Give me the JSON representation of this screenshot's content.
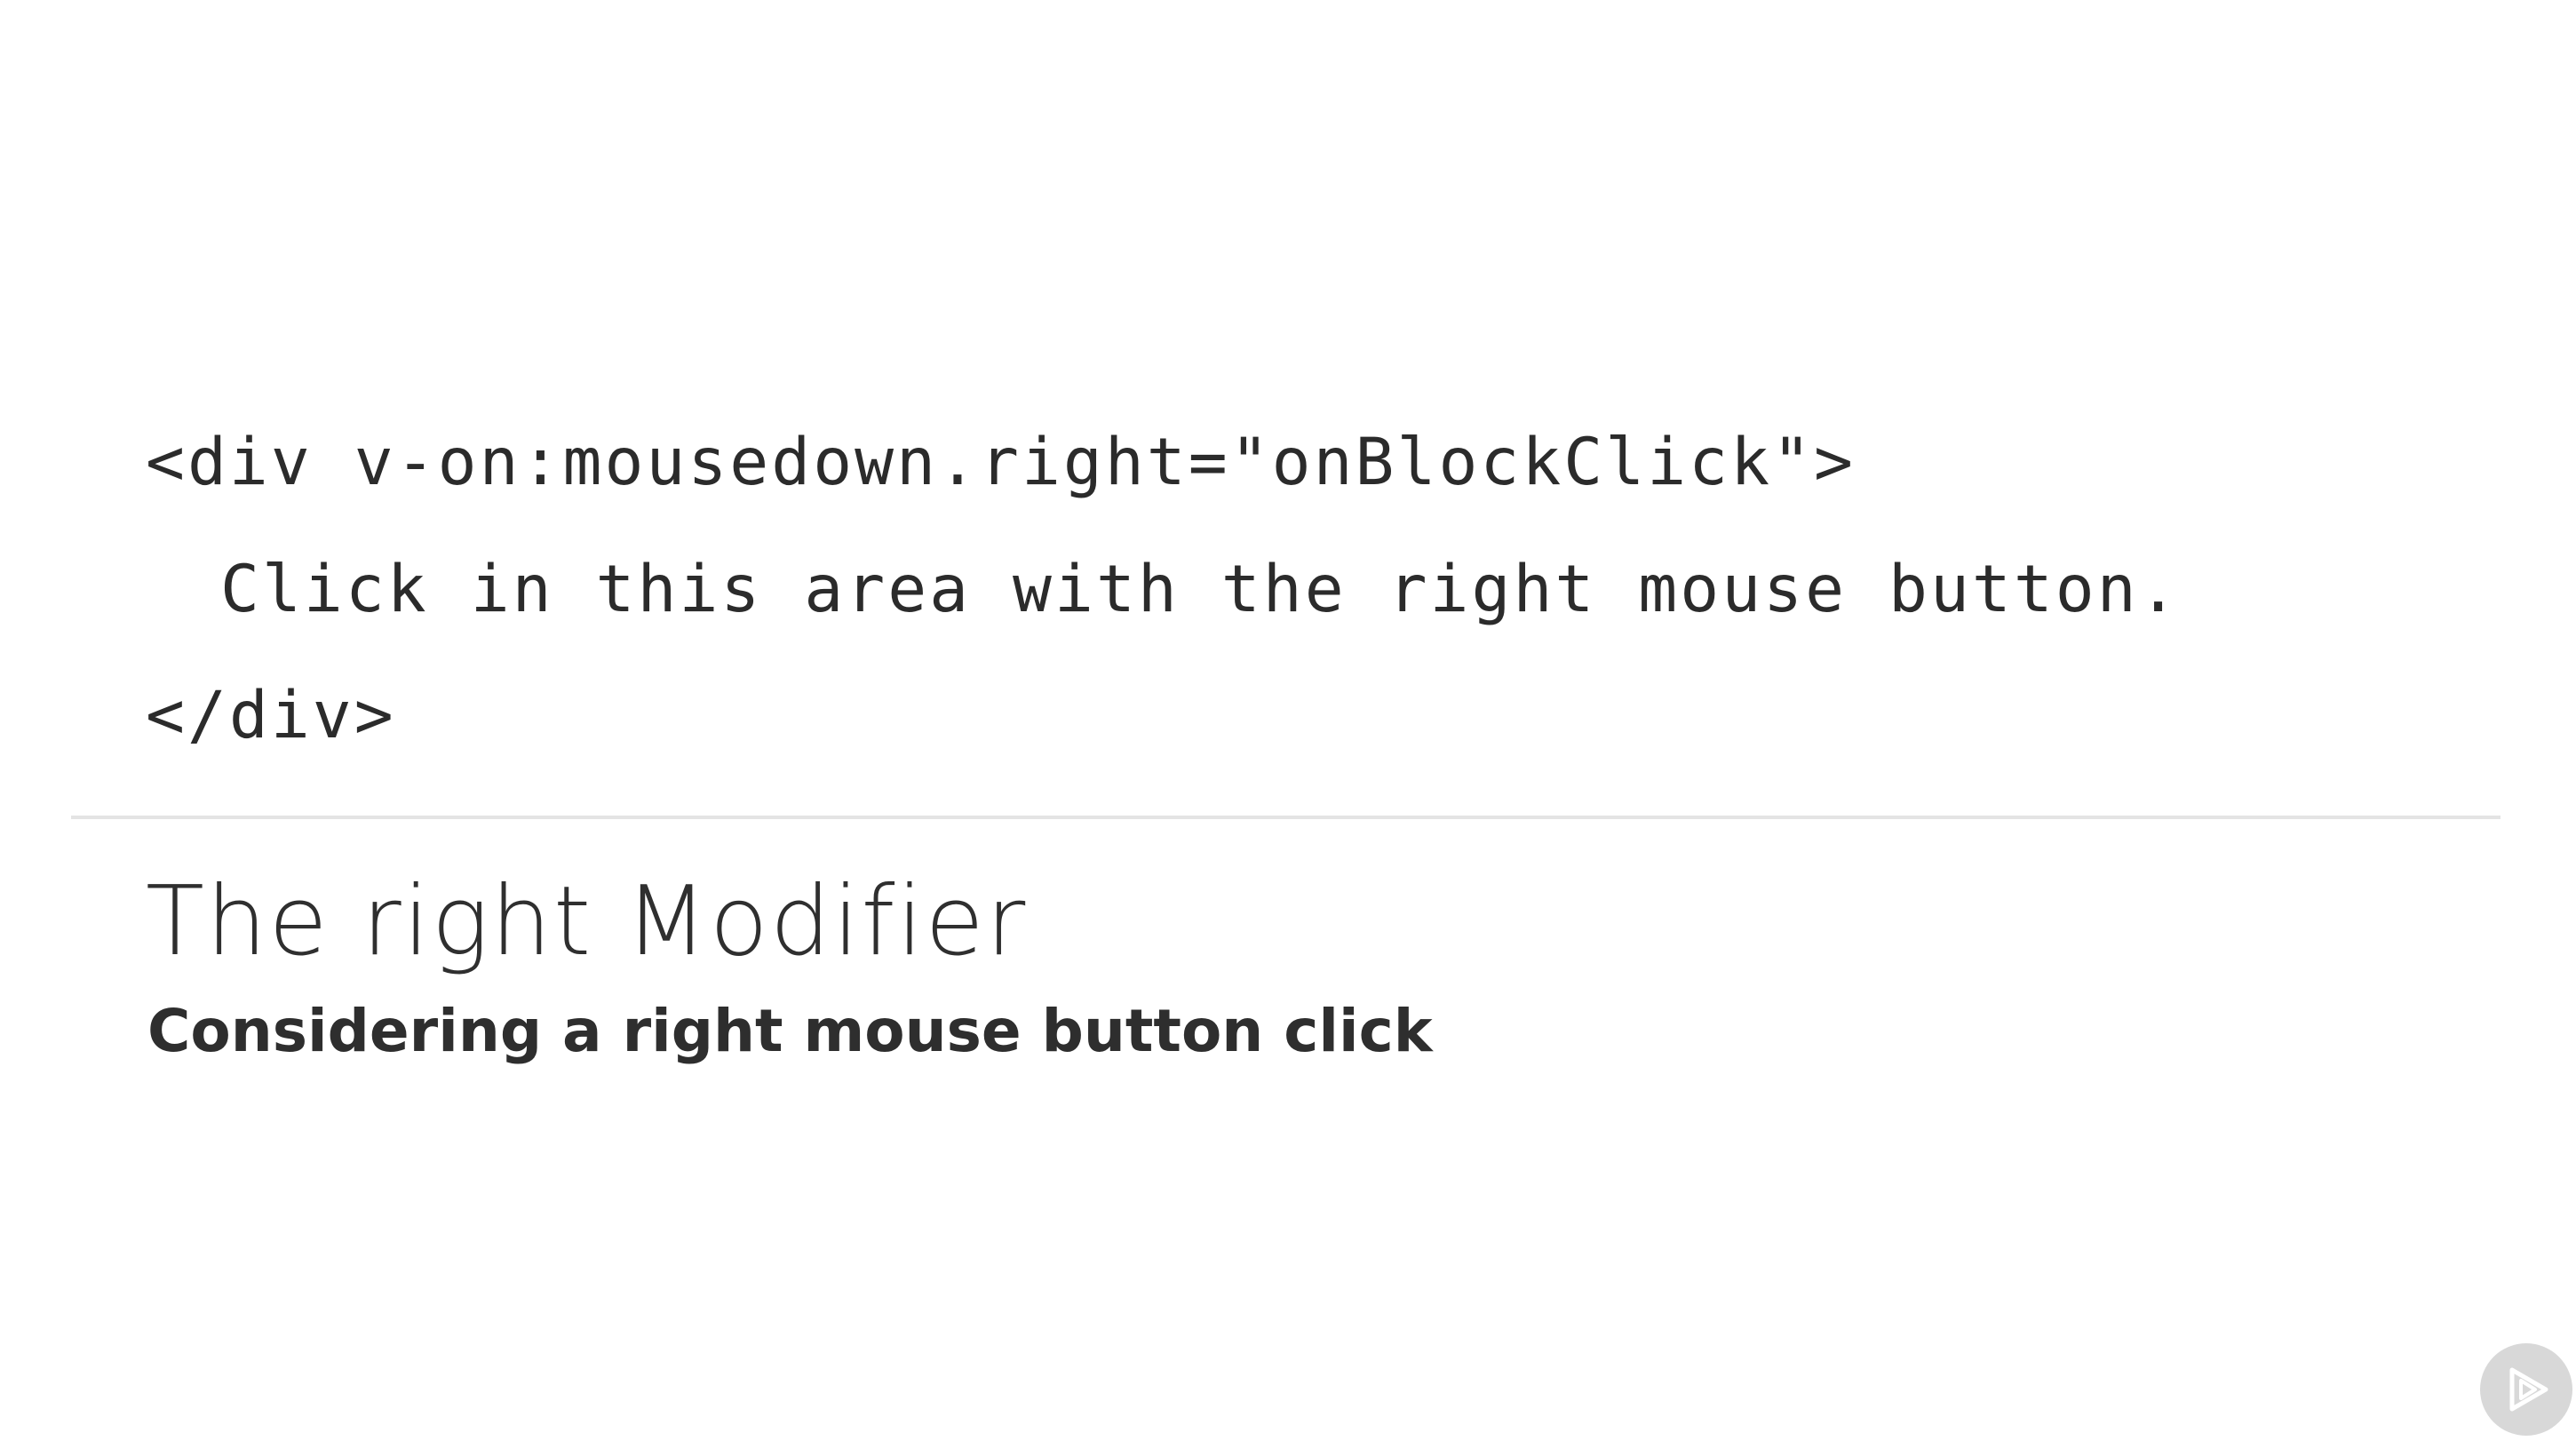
{
  "code": {
    "line1": "<div v-on:mousedown.right=\"onBlockClick\">",
    "line2": "Click in this area with the right mouse button.",
    "line3": "</div>"
  },
  "slide": {
    "title": "The right Modifier",
    "subtitle": "Considering a right mouse button click"
  },
  "logo": {
    "icon": "play-logo-icon"
  }
}
